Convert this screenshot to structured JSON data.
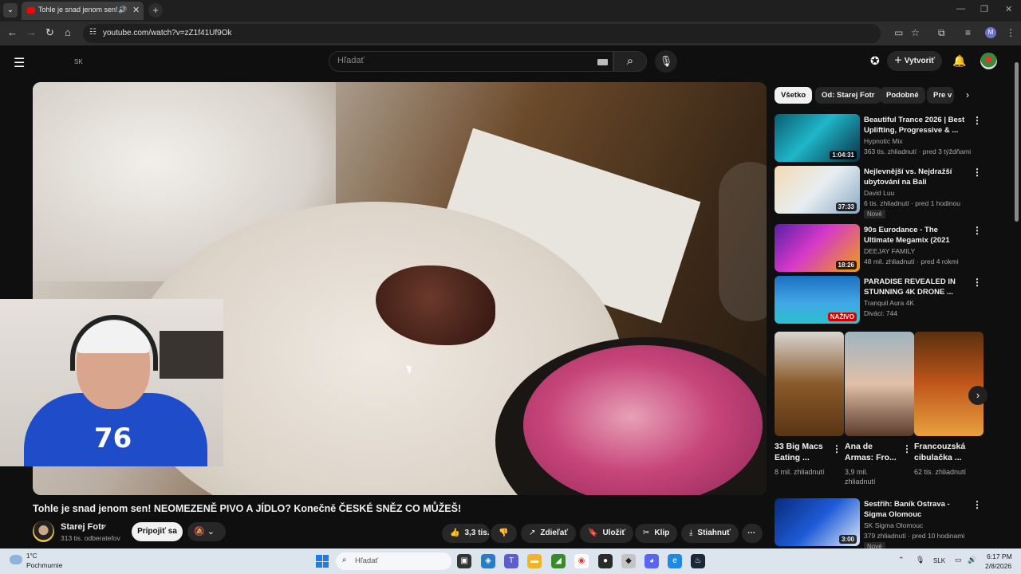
{
  "browser": {
    "tab_title": "Tohle je snad jenom sen! N",
    "url": "youtube.com/watch?v=zZ1f41Uf9Ok",
    "profile_initial": "M"
  },
  "header": {
    "region": "SK",
    "search_placeholder": "Hľadať",
    "create_label": "Vytvoriť"
  },
  "video": {
    "title": "Tohle je snad jenom sen! NEOMEZENĚ PIVO A JÍDLO? Konečně ČESKÉ SNĚZ CO MŮŽEŠ!",
    "webcam_jersey_number": "76",
    "channel_name": "Starej Fotr",
    "channel_subs": "313 tis. odberateľov",
    "subscribe_label": "Pripojiť sa",
    "actions": {
      "likes": "3,3 tis.",
      "share": "Zdieľať",
      "save": "Uložiť",
      "clip": "Klip",
      "download": "Stiahnuť"
    }
  },
  "chips": [
    {
      "label": "Všetko",
      "active": true
    },
    {
      "label": "Od: Starej Fotr",
      "active": false
    },
    {
      "label": "Podobné",
      "active": false
    },
    {
      "label": "Pre v",
      "active": false
    }
  ],
  "recommendations": [
    {
      "title": "Beautiful Trance 2026 | Best Uplifting, Progressive & ...",
      "channel": "Hypnotic Mix",
      "meta": "363 tis. zhliadnutí · pred 3 týždňami",
      "duration": "1:04:31",
      "badge": ""
    },
    {
      "title": "Nejlevnější vs. Nejdražší ubytování na Bali",
      "channel": "David Luu",
      "meta": "6 tis. zhliadnutí · pred 1 hodinou",
      "duration": "37:33",
      "badge": "Nové"
    },
    {
      "title": "90s Eurodance - The Ultimate Megamix (2021 Edition)",
      "channel": "DEEJAY FAMILY",
      "meta": "48 mil. zhliadnutí · pred 4 rokmi",
      "duration": "18:26",
      "badge": ""
    },
    {
      "title": "PARADISE REVEALED IN STUNNING 4K DRONE ...",
      "channel": "Tranquil Aura 4K",
      "meta": "Diváci: 744",
      "duration": "NAŽIVO",
      "badge": ""
    }
  ],
  "shorts": [
    {
      "title": "33 Big Macs Eating ...",
      "views": "8 mil. zhliadnutí"
    },
    {
      "title": "Ana de Armas: Fro...",
      "views": "3,9 mil. zhliadnutí"
    },
    {
      "title": "Francouzská cibulačka ...",
      "views": "62 tis. zhliadnutí"
    }
  ],
  "recommendation_bottom": {
    "title": "Sestřih: Baník Ostrava - Sigma Olomouc",
    "channel": "SK Sigma Olomouc",
    "meta": "379 zhliadnutí · pred 10 hodinami",
    "duration": "3:00",
    "badge": "Nové"
  },
  "taskbar": {
    "temperature": "1°C",
    "weather": "Pochmurnie",
    "search_placeholder": "Hľadať",
    "language": "SLK",
    "time": "6:17 PM",
    "date": "2/8/2026"
  }
}
